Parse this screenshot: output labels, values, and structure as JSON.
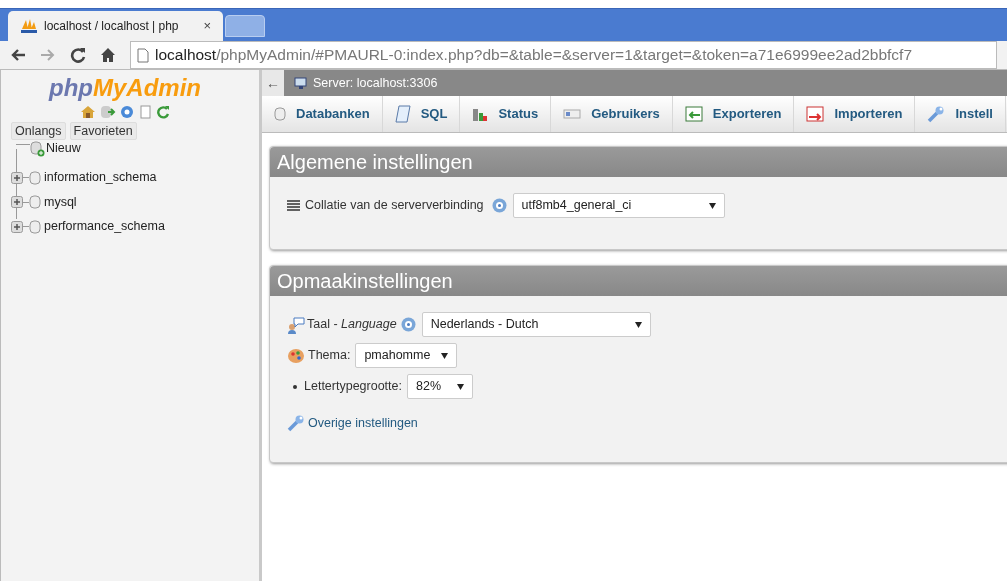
{
  "browser": {
    "tab_title": "localhost / localhost | php",
    "tab_close": "×",
    "url_host": "localhost",
    "url_rest": "/phpMyAdmin/#PMAURL-0:index.php?db=&table=&server=1&target=&token=a71e6999ee2ad2bbfcf7"
  },
  "sidebar": {
    "logo": {
      "prefix": "php",
      "name": "MyAdmin"
    },
    "tabs": [
      "Onlangs",
      "Favorieten"
    ],
    "tree": [
      {
        "label": "Nieuw",
        "kind": "new"
      },
      {
        "label": "information_schema",
        "kind": "database"
      },
      {
        "label": "mysql",
        "kind": "database"
      },
      {
        "label": "performance_schema",
        "kind": "database"
      }
    ]
  },
  "breadcrumb": {
    "back": "←",
    "server": "Server: localhost:3306"
  },
  "tabs": [
    {
      "label": "Databanken",
      "kind": "database"
    },
    {
      "label": "SQL",
      "kind": "sql"
    },
    {
      "label": "Status",
      "kind": "status"
    },
    {
      "label": "Gebruikers",
      "kind": "users"
    },
    {
      "label": "Exporteren",
      "kind": "export"
    },
    {
      "label": "Importeren",
      "kind": "import"
    },
    {
      "label": "Instell",
      "kind": "settings"
    }
  ],
  "general_settings": {
    "title": "Algemene instellingen",
    "collation_label": "Collatie van de serververbinding",
    "collation_value": "utf8mb4_general_ci"
  },
  "appearance_settings": {
    "title": "Opmaakinstellingen",
    "language_label": "Taal - *Language*",
    "language_value": "Nederlands - Dutch",
    "theme_label": "Thema:",
    "theme_value": "pmahomme",
    "font_size_label": "Lettertypegrootte:",
    "font_size_value": "82%",
    "more_link": "Overige instellingen"
  }
}
